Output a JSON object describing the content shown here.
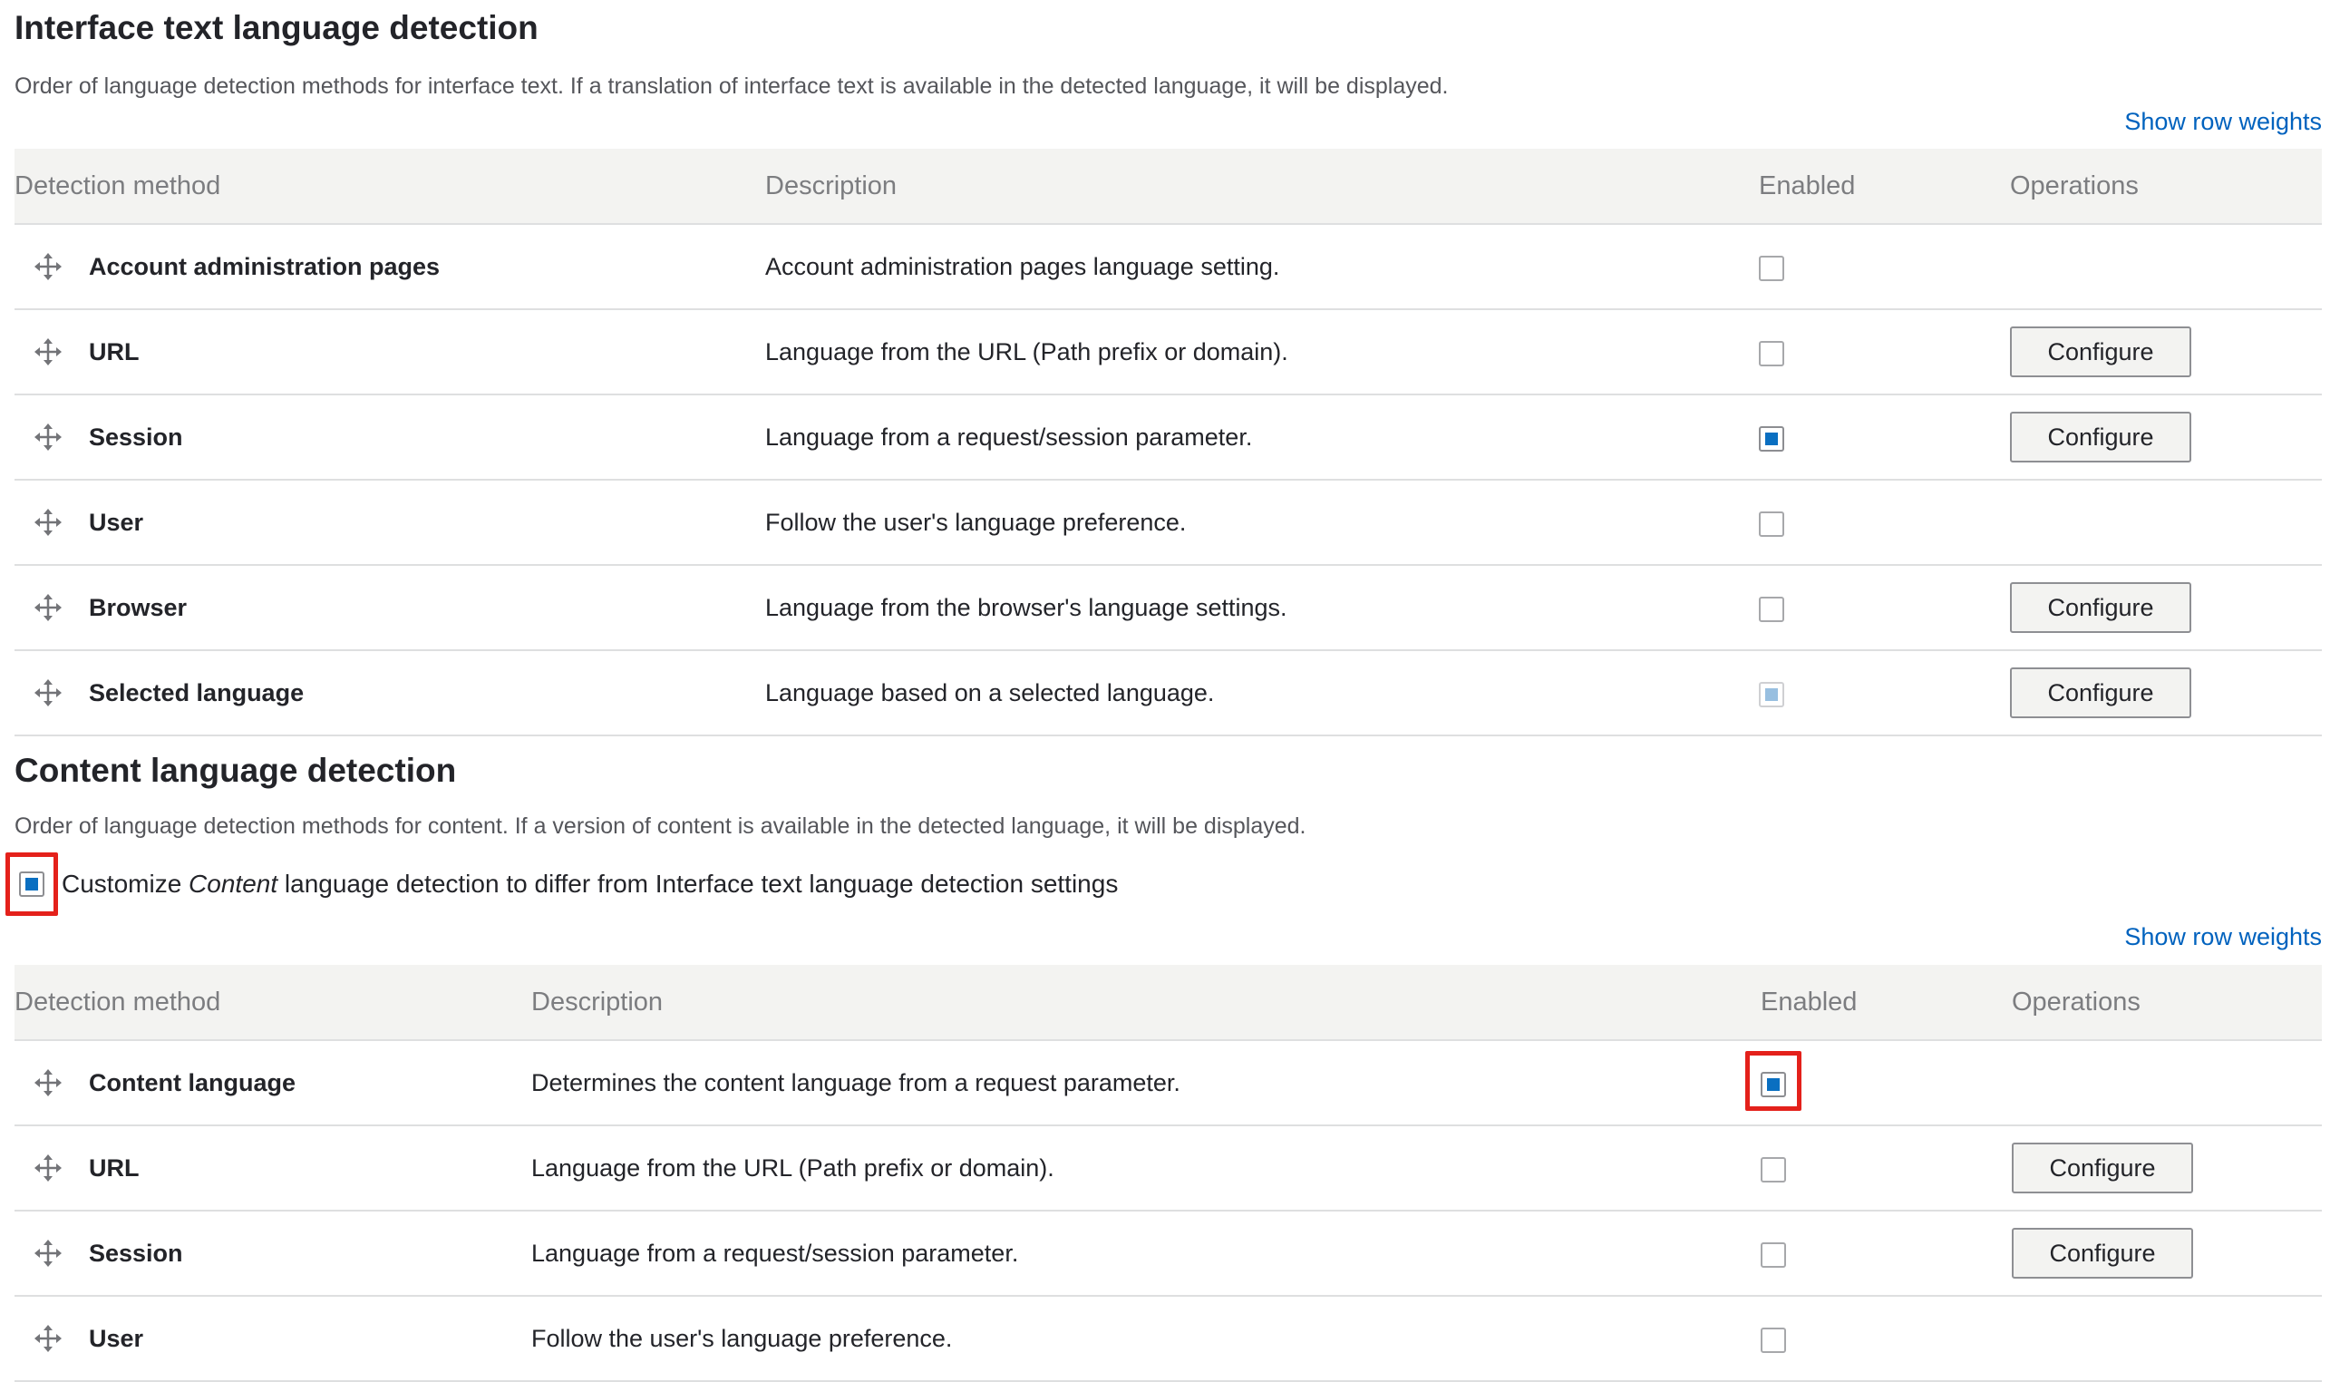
{
  "interface_section": {
    "title": "Interface text language detection",
    "description": "Order of language detection methods for interface text. If a translation of interface text is available in the detected language, it will be displayed.",
    "row_weights_link": "Show row weights",
    "columns": [
      "Detection method",
      "Description",
      "Enabled",
      "Operations"
    ],
    "rows": [
      {
        "name": "Account administration pages",
        "description": "Account administration pages language setting.",
        "enabled": false,
        "configure": null
      },
      {
        "name": "URL",
        "description": "Language from the URL (Path prefix or domain).",
        "enabled": false,
        "configure": "Configure"
      },
      {
        "name": "Session",
        "description": "Language from a request/session parameter.",
        "enabled": true,
        "configure": "Configure"
      },
      {
        "name": "User",
        "description": "Follow the user's language preference.",
        "enabled": false,
        "configure": null
      },
      {
        "name": "Browser",
        "description": "Language from the browser's language settings.",
        "enabled": false,
        "configure": "Configure"
      },
      {
        "name": "Selected language",
        "description": "Language based on a selected language.",
        "enabled": "disabled-checked",
        "configure": "Configure"
      }
    ]
  },
  "content_section": {
    "title": "Content language detection",
    "description": "Order of language detection methods for content. If a version of content is available in the detected language, it will be displayed.",
    "customize": {
      "prefix": "Customize ",
      "emphasis": "Content",
      "suffix": " language detection to differ from Interface text language detection settings",
      "checked": true
    },
    "row_weights_link": "Show row weights",
    "columns": [
      "Detection method",
      "Description",
      "Enabled",
      "Operations"
    ],
    "rows": [
      {
        "name": "Content language",
        "description": "Determines the content language from a request parameter.",
        "enabled": true,
        "configure": null
      },
      {
        "name": "URL",
        "description": "Language from the URL (Path prefix or domain).",
        "enabled": false,
        "configure": "Configure"
      },
      {
        "name": "Session",
        "description": "Language from a request/session parameter.",
        "enabled": false,
        "configure": "Configure"
      },
      {
        "name": "User",
        "description": "Follow the user's language preference.",
        "enabled": false,
        "configure": null
      }
    ]
  },
  "colors": {
    "link": "#0062be",
    "checkbox_fill": "#0a6fc1",
    "highlight": "#e4211b",
    "table_header_bg": "#f3f3f1"
  },
  "icons": {
    "drag_handle": "move-arrows-icon"
  }
}
